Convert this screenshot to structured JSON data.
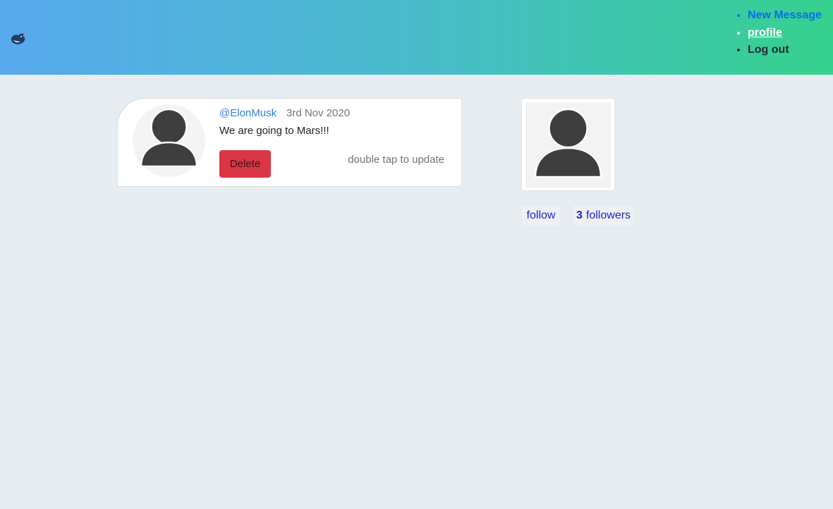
{
  "header": {
    "logo_icon": "bird-logo-icon",
    "gradient": [
      "#58a9ee",
      "#35d18e"
    ],
    "nav": {
      "new_message": "New Message",
      "profile": "profile",
      "logout": "Log out"
    }
  },
  "post": {
    "handle": "@ElonMusk",
    "date": "3rd Nov 2020",
    "text": "We are going to Mars!!!",
    "delete_label": "Delete",
    "hint": "double tap to update",
    "avatar_icon": "user-avatar-icon"
  },
  "profile": {
    "avatar_icon": "user-avatar-icon",
    "follow_label": "follow",
    "followers_count": "3",
    "followers_label": "followers"
  },
  "colors": {
    "background": "#e7ecf0",
    "link": "#2f80d8",
    "danger": "#dc3545",
    "follow": "#1f1fd1"
  }
}
